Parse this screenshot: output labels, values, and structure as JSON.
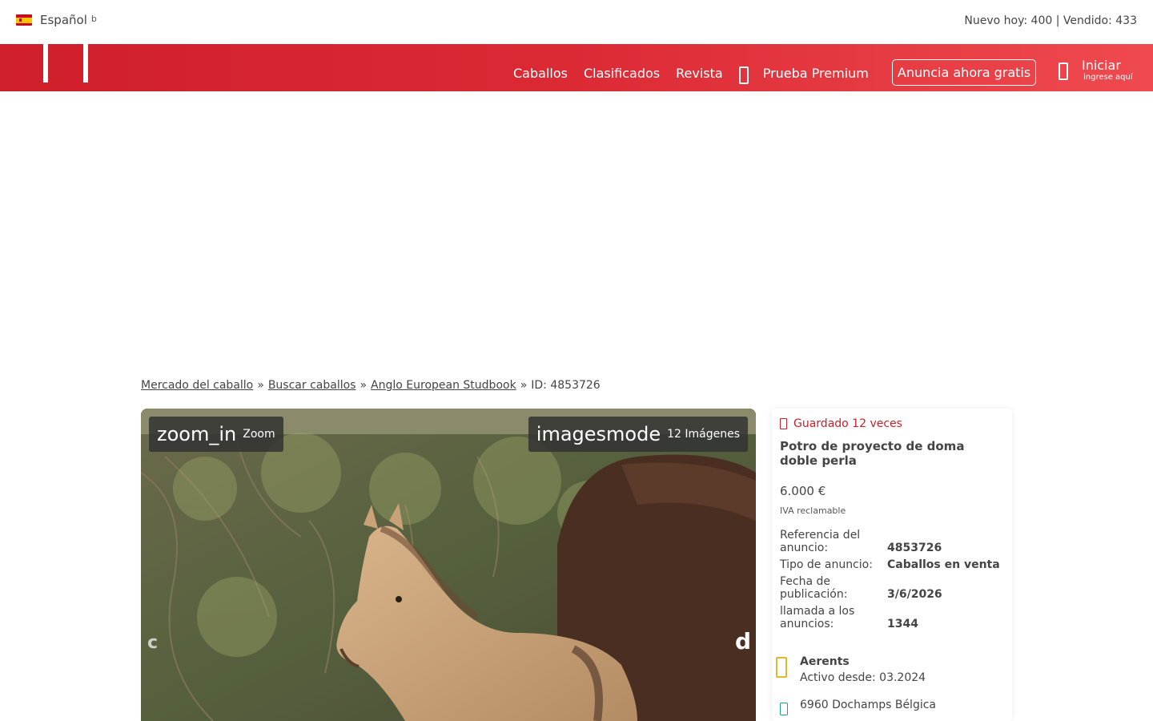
{
  "topbar": {
    "language": "Español",
    "language_caret": "b",
    "stats": "Nuevo hoy: 400 | Vendido: 433"
  },
  "nav": {
    "links": [
      "Caballos",
      "Clasificados",
      "Revista"
    ],
    "premium": "Prueba Premium",
    "cta": "Anuncia ahora gratis",
    "login": "Iniciar",
    "login_sub": "ingrese aquí"
  },
  "breadcrumb": {
    "items": [
      "Mercado del caballo",
      "Buscar caballos",
      "Anglo European Studbook"
    ],
    "current": "ID: 4853726",
    "separator": "»"
  },
  "gallery": {
    "zoom_icon": "zoom_in",
    "zoom_label": "Zoom",
    "images_icon": "imagesmode",
    "images_label": "12 Imágenes",
    "prev_glyph": "c",
    "next_glyph": "d"
  },
  "listing": {
    "saved": "Guardado 12 veces",
    "title": "Potro de proyecto de doma doble perla",
    "price": "6.000 €",
    "vat": "IVA reclamable",
    "specs": [
      {
        "label": "Referencia del anuncio:",
        "value": "4853726"
      },
      {
        "label": "Tipo de anuncio:",
        "value": "Caballos en venta"
      },
      {
        "label": "Fecha de publicación:",
        "value": "3/6/2026"
      },
      {
        "label": "llamada a los anuncios:",
        "value": "1344"
      }
    ],
    "seller_name": "Aerents",
    "seller_since": "Activo desde: 03.2024",
    "location": "6960 Dochamps Bélgica"
  },
  "colors": {
    "brand_red": "#d42a34",
    "seller_icon": "#e2b72a",
    "location_icon": "#1aa58a"
  }
}
